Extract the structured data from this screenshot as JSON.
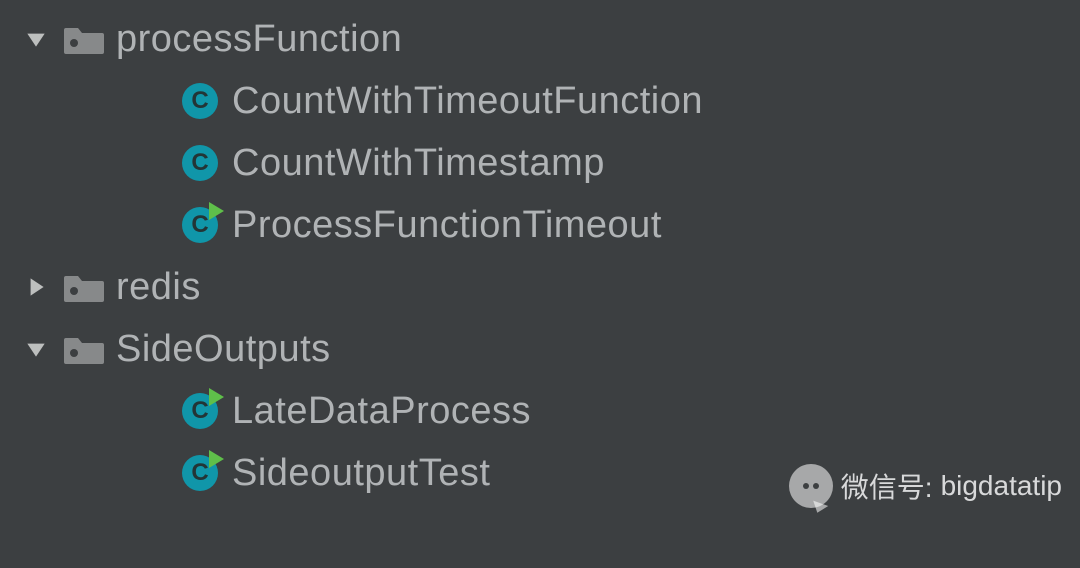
{
  "tree": [
    {
      "type": "folder",
      "expanded": true,
      "label": "processFunction",
      "indent": 1
    },
    {
      "type": "class",
      "runnable": false,
      "label": "CountWithTimeoutFunction",
      "indent": 2
    },
    {
      "type": "class",
      "runnable": false,
      "label": "CountWithTimestamp",
      "indent": 2
    },
    {
      "type": "class",
      "runnable": true,
      "label": "ProcessFunctionTimeout",
      "indent": 2
    },
    {
      "type": "folder",
      "expanded": false,
      "label": "redis",
      "indent": 1
    },
    {
      "type": "folder",
      "expanded": true,
      "label": "SideOutputs",
      "indent": 1
    },
    {
      "type": "class",
      "runnable": true,
      "label": "LateDataProcess",
      "indent": 2
    },
    {
      "type": "class",
      "runnable": true,
      "label": "SideoutputTest",
      "indent": 2
    }
  ],
  "classLetter": "C",
  "watermark": {
    "prefix": "微信号:",
    "id": "bigdatatip"
  },
  "colors": {
    "bg": "#3c3f41",
    "text": "#b0b3b5",
    "arrow": "#bdbfbe",
    "folder": "#87898a",
    "classCircle": "#1096a9",
    "runBadge": "#5fbf4a"
  }
}
